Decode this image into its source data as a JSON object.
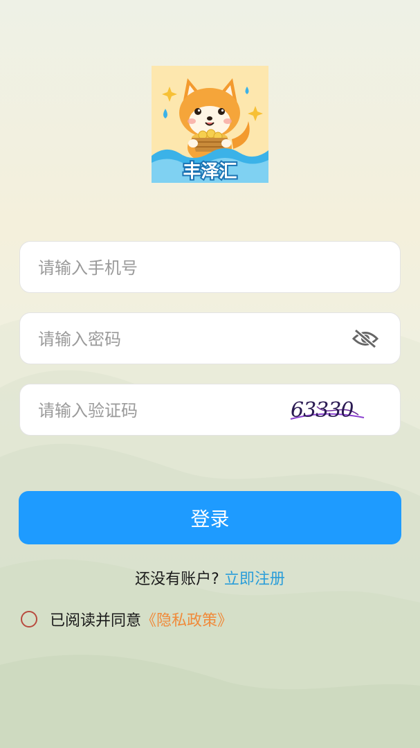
{
  "app": {
    "logo_text": "丰泽汇"
  },
  "form": {
    "phone_placeholder": "请输入手机号",
    "password_placeholder": "请输入密码",
    "captcha_placeholder": "请输入验证码",
    "captcha_code": "63330",
    "password_toggle_icon": "eye-off-icon"
  },
  "actions": {
    "login_label": "登录",
    "no_account_text": "还没有账户?",
    "register_label": "立即注册"
  },
  "agreement": {
    "text": "已阅读并同意",
    "policy_label": "《隐私政策》"
  },
  "colors": {
    "primary": "#1e9bff",
    "link": "#2a9dd9",
    "policy": "#f08a3a",
    "radio": "#b84a3e"
  }
}
